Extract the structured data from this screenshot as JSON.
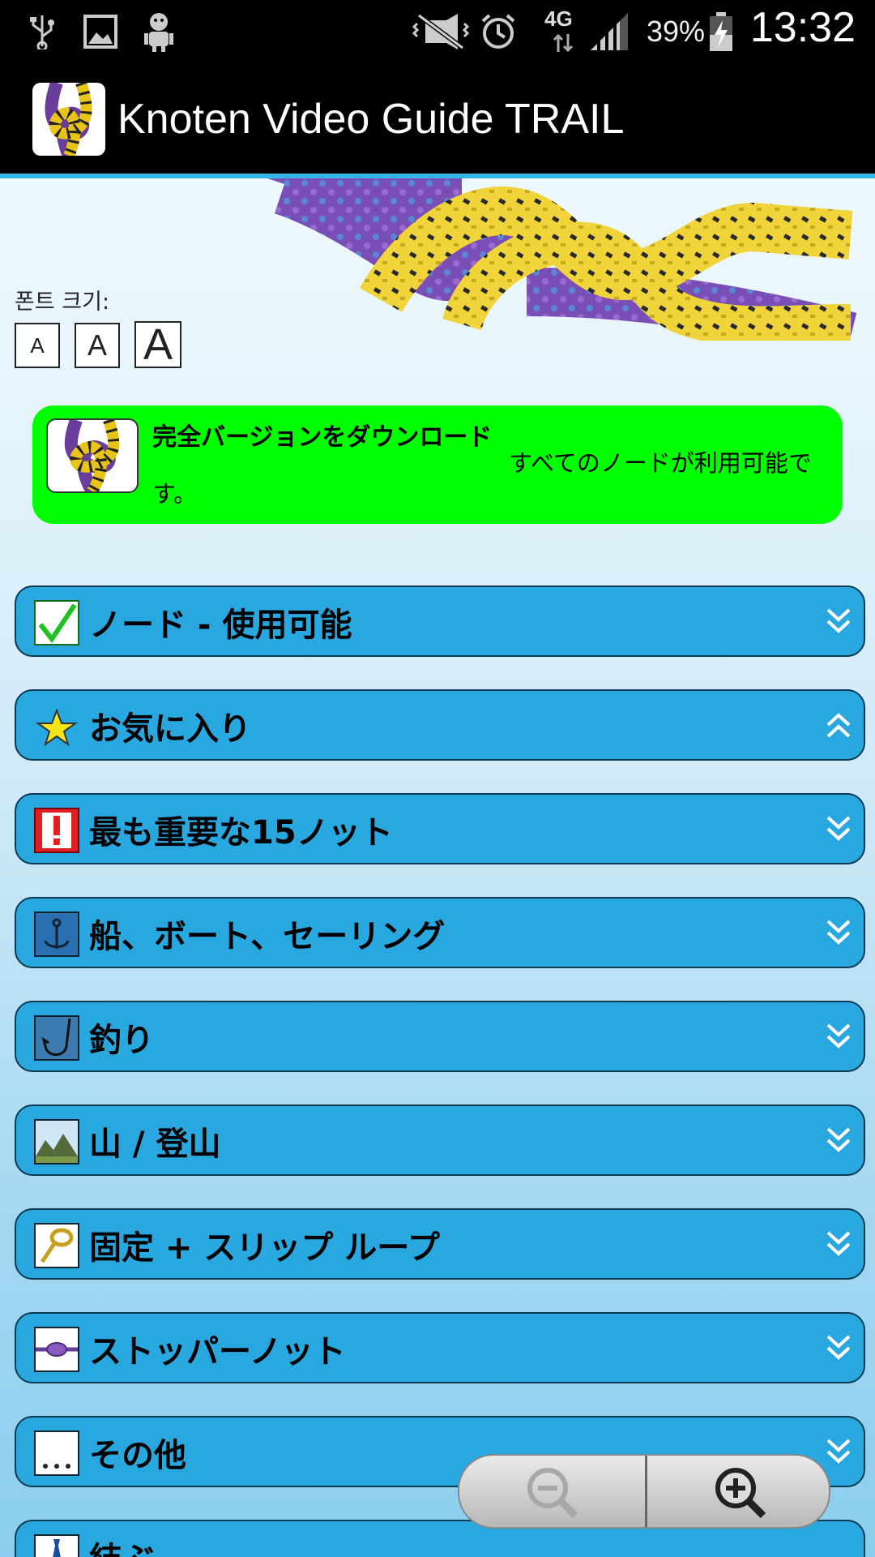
{
  "status_bar": {
    "network": "4G",
    "battery": "39%",
    "time": "13:32"
  },
  "app": {
    "title": "Knoten Video Guide TRAIL"
  },
  "font_size": {
    "label": "폰트 크기:",
    "buttons": [
      "A",
      "A",
      "A"
    ]
  },
  "promo": {
    "title": "完全バージョンをダウンロード",
    "subtitle": "すべてのノードが利用可能です。"
  },
  "categories": [
    {
      "label": "ノード - 使用可能",
      "icon": "checkmark-icon",
      "expanded": false
    },
    {
      "label": "お気に入り",
      "icon": "star-icon",
      "expanded": true
    },
    {
      "label": "最も重要な15ノット",
      "icon": "exclamation-icon",
      "expanded": false
    },
    {
      "label": "船、ボート、セーリング",
      "icon": "anchor-icon",
      "expanded": false
    },
    {
      "label": "釣り",
      "icon": "fishing-hook-icon",
      "expanded": false
    },
    {
      "label": "山 / 登山",
      "icon": "mountain-icon",
      "expanded": false
    },
    {
      "label": "固定 + スリップ ループ",
      "icon": "loop-icon",
      "expanded": false
    },
    {
      "label": "ストッパーノット",
      "icon": "stopper-knot-icon",
      "expanded": false
    },
    {
      "label": "その他",
      "icon": "ellipsis-icon",
      "expanded": false
    },
    {
      "label": "結ぶ",
      "icon": "tie-icon",
      "expanded": false
    }
  ],
  "colors": {
    "category_bg": "#29a8e0",
    "promo_bg": "#00ff00",
    "accent": "#33b5e5"
  }
}
